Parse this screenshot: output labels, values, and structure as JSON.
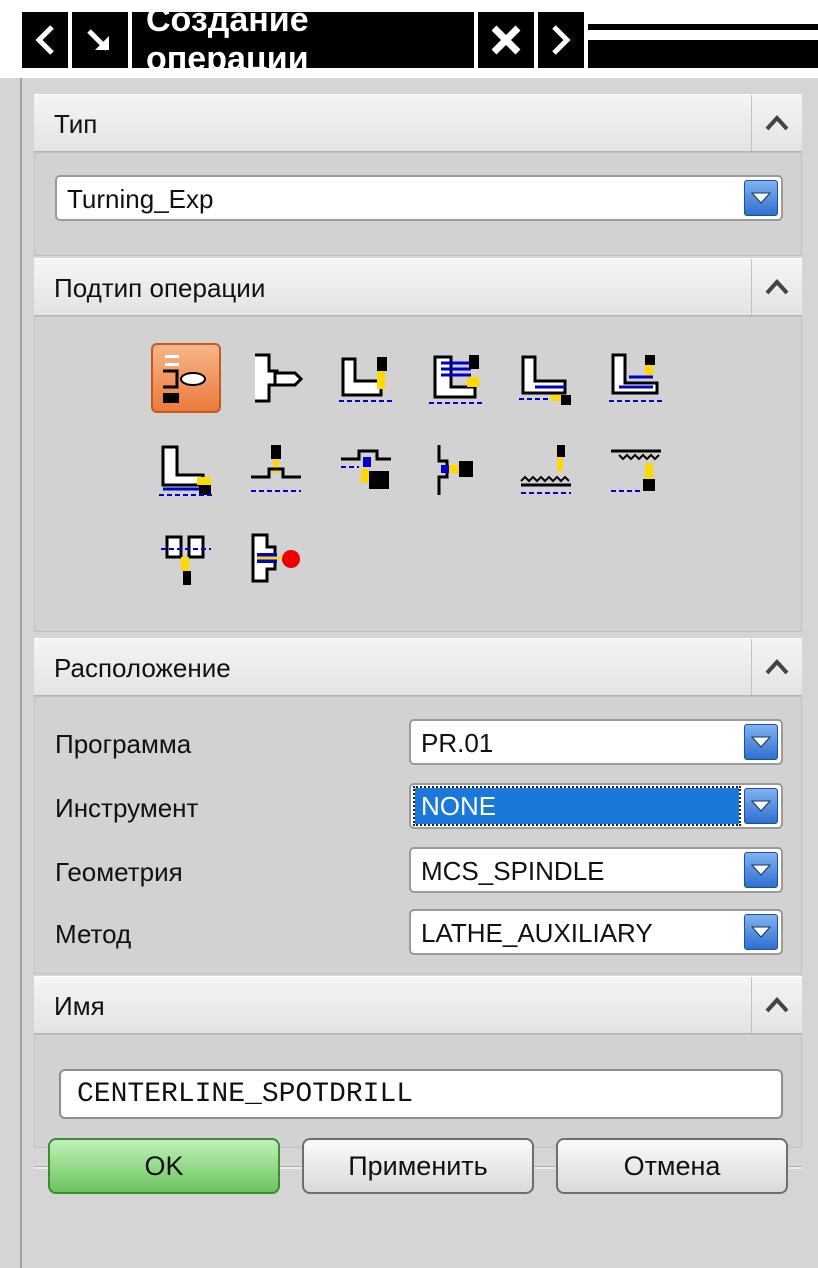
{
  "window": {
    "title": "Создание операции"
  },
  "sections": {
    "type": {
      "label": "Тип",
      "value": "Turning_Exp"
    },
    "subtype": {
      "label": "Подтип операции",
      "icons": [
        "facing-op-icon",
        "centerline-drill-op-icon",
        "rough-turn-od-icon",
        "rough-back-turn-icon",
        "rough-bore-id-icon",
        "rough-back-bore-icon",
        "finish-turn-od-icon",
        "groove-od-icon",
        "groove-id-icon",
        "groove-face-icon",
        "thread-od-icon",
        "thread-id-icon",
        "part-off-icon",
        "lathe-user-icon"
      ],
      "selected_icon": "facing-op-icon"
    },
    "location": {
      "label": "Расположение",
      "fields": [
        {
          "label": "Программа",
          "value": "PR.01"
        },
        {
          "label": "Инструмент",
          "value": "NONE"
        },
        {
          "label": "Геометрия",
          "value": "MCS_SPINDLE"
        },
        {
          "label": "Метод",
          "value": "LATHE_AUXILIARY"
        }
      ]
    },
    "name": {
      "label": "Имя",
      "value": "CENTERLINE_SPOTDRILL"
    }
  },
  "buttons": {
    "ok": "OK",
    "apply": "Применить",
    "cancel": "Отмена"
  },
  "colors": {
    "selection": "#1a78d8",
    "ok_button": "#6cc45e",
    "active_icon": "#ec7a3c"
  }
}
